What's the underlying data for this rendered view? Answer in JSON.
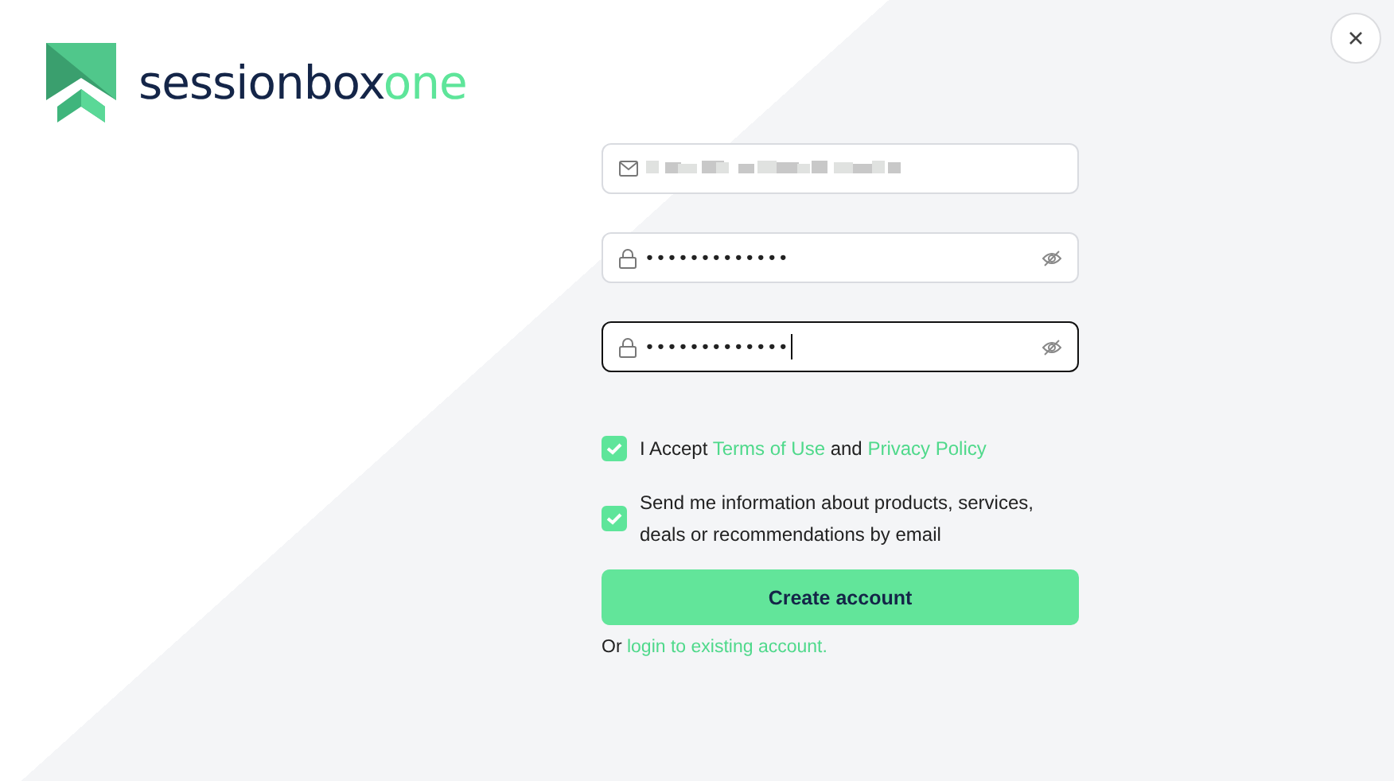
{
  "logo": {
    "name": "sessionbox",
    "suffix": "one"
  },
  "fields": [
    {
      "kind": "email",
      "redacted": true,
      "focused": false
    },
    {
      "kind": "password",
      "value": "•••••••••••••",
      "redacted": false,
      "focused": false
    },
    {
      "kind": "password",
      "value": "•••••••••••••",
      "redacted": false,
      "focused": true
    }
  ],
  "consents": [
    {
      "checked": true,
      "parts": [
        {
          "text": "I Accept ",
          "link": false
        },
        {
          "text": "Terms of Use",
          "link": true
        },
        {
          "text": " and ",
          "link": false
        },
        {
          "text": "Privacy Policy",
          "link": true
        }
      ]
    },
    {
      "checked": true,
      "parts": [
        {
          "text": "Send me information about products, services, deals or recommendations by email",
          "link": false
        }
      ]
    }
  ],
  "submit": "Create account",
  "footer": {
    "prefix": "Or ",
    "link": "login to existing account."
  }
}
